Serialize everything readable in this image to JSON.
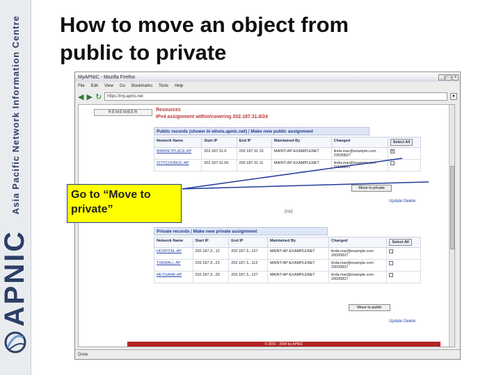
{
  "sidebar": {
    "org_text": "Asia Pacific Network Information Centre",
    "brand": "APNIC"
  },
  "slide": {
    "title_line1": "How to move an object from",
    "title_line2": "public to private"
  },
  "browser": {
    "title": "MyAPNIC - Mozilla Firefox",
    "menu": [
      "File",
      "Edit",
      "View",
      "Go",
      "Bookmarks",
      "Tools",
      "Help"
    ],
    "url": "https://my.apnic.net",
    "status": "Done",
    "window_buttons": [
      "_",
      "□",
      "x"
    ]
  },
  "page": {
    "remember_button": "REMEMBER",
    "resources_link": "Resources",
    "ipv4_heading": "IPv4 assignment within/covering 202.187.31.0/24",
    "public_section": {
      "title": "Public records (shown in whois.apnic.net)",
      "make_link": "Make new public assignment",
      "columns": [
        "Network Name",
        "Start IP",
        "End IP",
        "Maintained By",
        "Changed"
      ],
      "select_all": "Select All",
      "rows": [
        {
          "name": "MARKETPLACE-AP",
          "start": "202.187.31.0",
          "end": "202.187.31.15",
          "maint": "MAINT-AP-EXAMPLENET",
          "changed_email": "linda.mar@example.com",
          "changed_date": "20030827",
          "checked": "x"
        },
        {
          "name": "CITYCOUNCIL-AP",
          "start": "202.187.31.00",
          "end": "202.187.31.11",
          "maint": "MAINT-AP-EXAMPLENET",
          "changed_email": "linda.mar@example.com",
          "changed_date": "20030827",
          "checked": ""
        }
      ],
      "move_button": "Move to private"
    },
    "top_link": "[top]",
    "update_delete_1": "Update Delete",
    "private_section": {
      "title": "Private records",
      "make_link": "Make new private assignment",
      "columns": [
        "Network Name",
        "Start IP",
        "End IP",
        "Maintained By",
        "Changed"
      ],
      "select_all": "Select All",
      "rows": [
        {
          "name": "HOSPITAL-AP",
          "start": "202.187.3...12",
          "end": "202.187.3...127",
          "maint": "MAINT-AP-EXAMPLENET",
          "changed_email": "linda.mar@example.com",
          "changed_date": "20030827"
        },
        {
          "name": "THEMALL-AP",
          "start": "202.187.3...23",
          "end": "202.187.3...113",
          "maint": "MAINT-AP-EXAMPLENET",
          "changed_email": "linda.mar@example.com",
          "changed_date": "20030827"
        },
        {
          "name": "NETGAME-AP",
          "start": "202.187.3...33",
          "end": "202.187.3...127",
          "maint": "MAINT-AP-EXAMPLENET",
          "changed_email": "linda.mar@example.com",
          "changed_date": "20030827"
        }
      ],
      "move_button": "Move to public"
    },
    "update_delete_2": "Update Delete",
    "footer": "© 2001 - 2004 by APNIC"
  },
  "callout": {
    "line1": "Go to “Move to",
    "line2": "private”"
  },
  "colors": {
    "callout_bg": "#ffff00",
    "callout_border": "#1f3a99",
    "heading_red": "#bb3333",
    "link_blue": "#2244aa"
  }
}
